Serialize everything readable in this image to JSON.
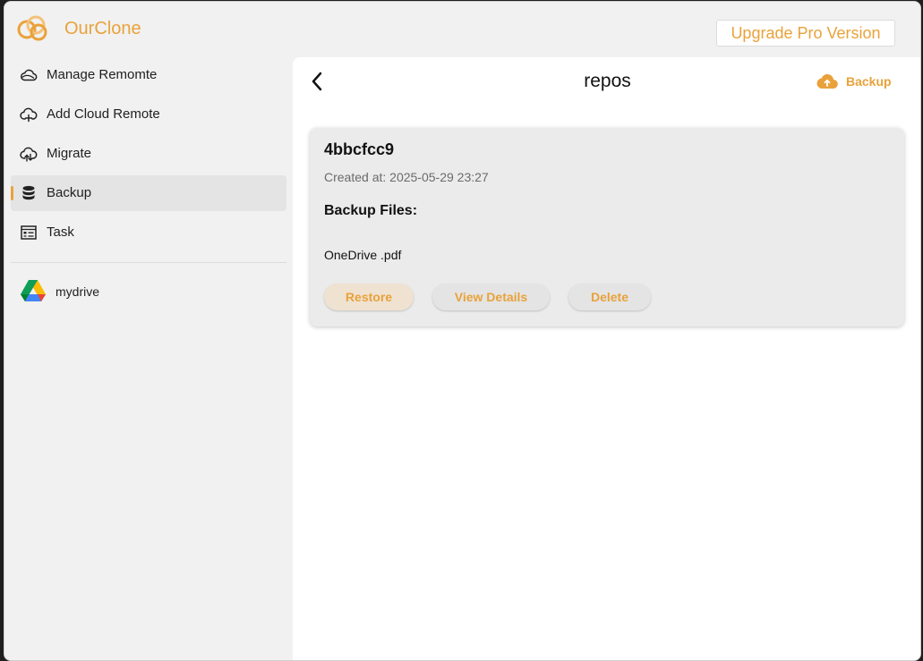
{
  "app": {
    "title": "OurClone",
    "upgrade_label": "Upgrade Pro Version",
    "accent_color": "#e9a23b"
  },
  "sidebar": {
    "items": [
      {
        "label": "Manage Remomte",
        "icon": "cloud-icon",
        "active": false
      },
      {
        "label": "Add Cloud Remote",
        "icon": "cloud-plus-icon",
        "active": false
      },
      {
        "label": "Migrate",
        "icon": "cloud-sync-icon",
        "active": false
      },
      {
        "label": "Backup",
        "icon": "database-icon",
        "active": true
      },
      {
        "label": "Task",
        "icon": "task-list-icon",
        "active": false
      }
    ],
    "remotes": [
      {
        "label": "mydrive",
        "icon": "google-drive-icon"
      }
    ]
  },
  "main": {
    "title": "repos",
    "backup_action_label": "Backup",
    "backups": [
      {
        "id": "4bbcfcc9",
        "created": "Created at: 2025-05-29 23:27",
        "files_heading": "Backup Files:",
        "files": [
          "OneDrive .pdf"
        ],
        "actions": {
          "restore": "Restore",
          "view_details": "View Details",
          "delete": "Delete"
        }
      }
    ]
  }
}
